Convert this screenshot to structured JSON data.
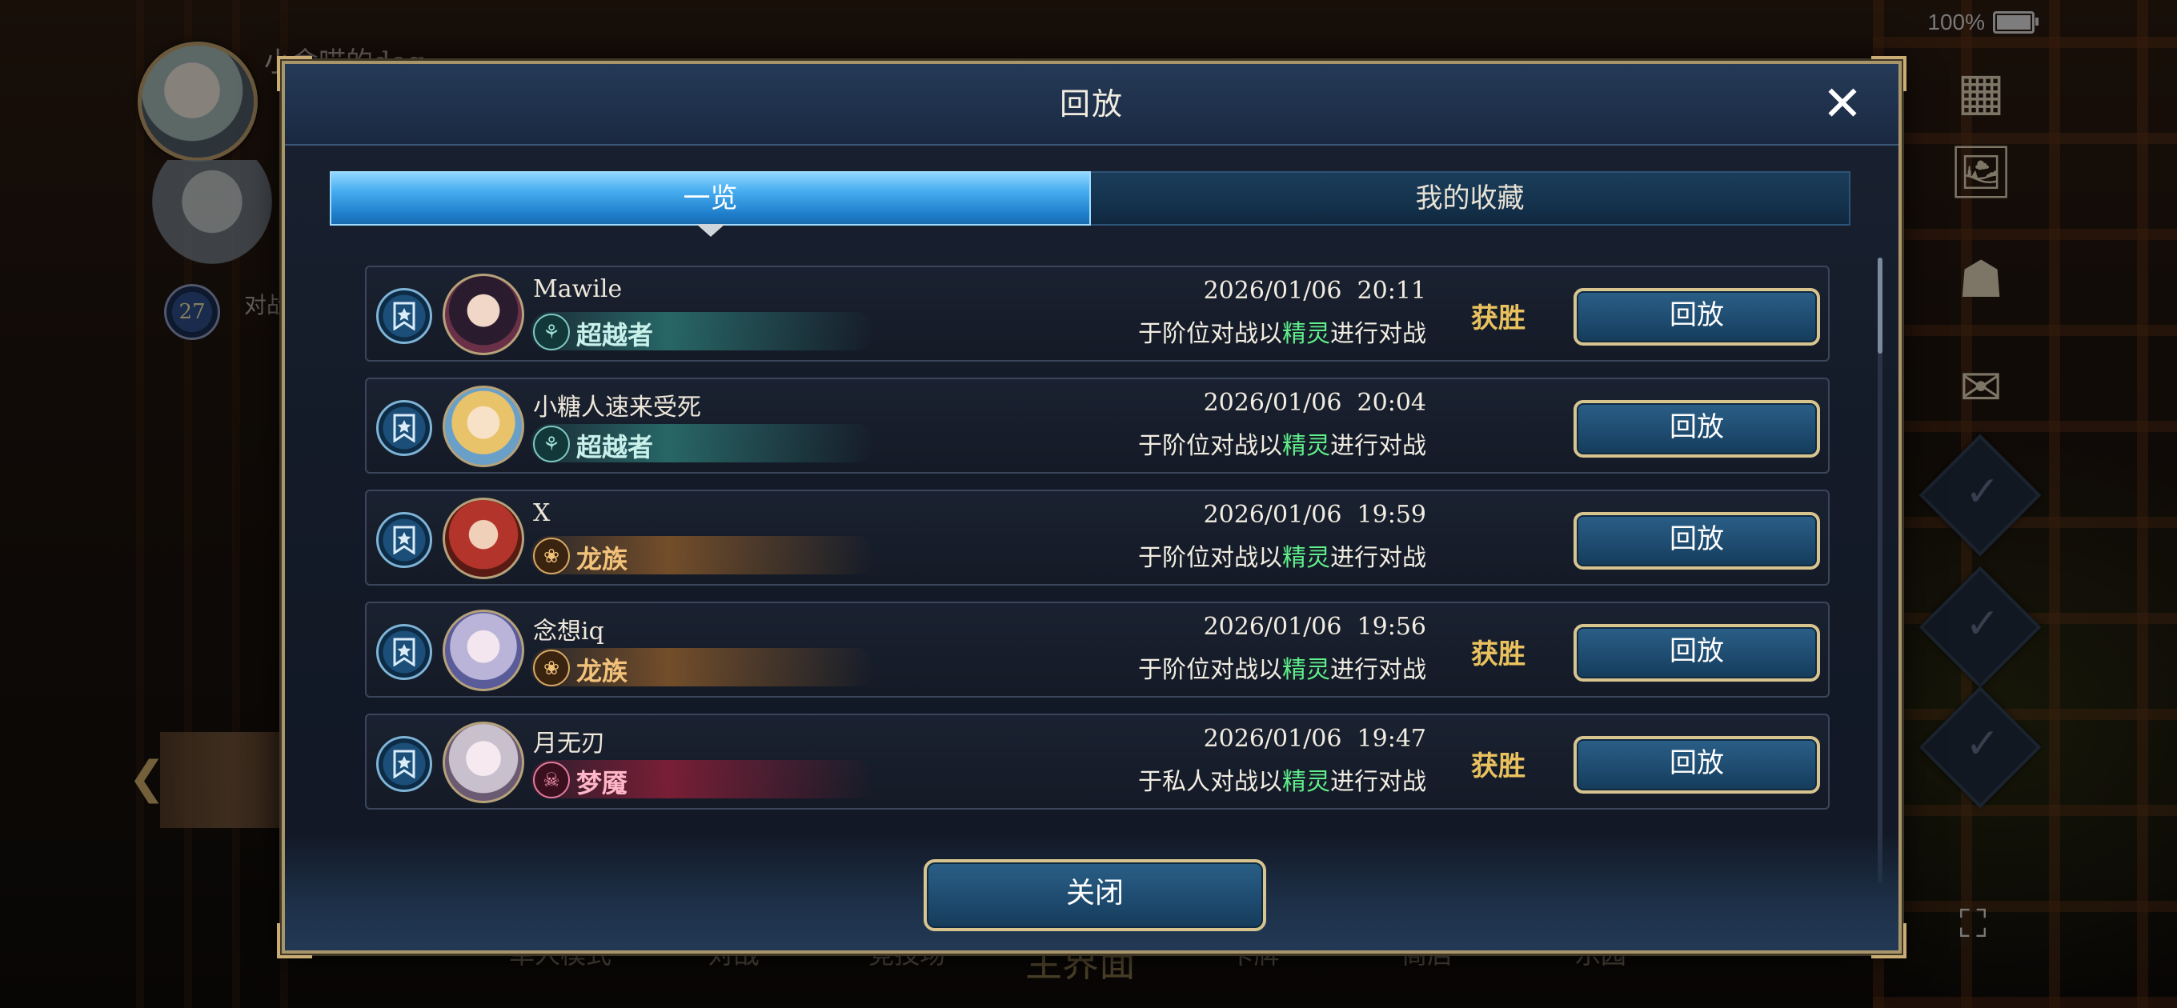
{
  "status": {
    "battery": "100%"
  },
  "background": {
    "player_name": "小舍喵的dog",
    "level": "27",
    "level_label": "对战进行中",
    "nav": [
      "单人模式",
      "对战",
      "竞技场",
      "主界面",
      "卡牌",
      "商店",
      "乐园"
    ]
  },
  "modal": {
    "title": "回放",
    "tabs": [
      {
        "label": "一览",
        "active": true
      },
      {
        "label": "我的收藏",
        "active": false
      }
    ],
    "rows": [
      {
        "player": "Mawile",
        "class": "超越者",
        "class_theme": "teal",
        "datetime": "2026/01/06  20:11",
        "desc_prefix": "于阶位对战以",
        "desc_highlight": "精灵",
        "desc_suffix": "进行对战",
        "result": "获胜",
        "button": "回放"
      },
      {
        "player": "小糖人速来受死",
        "class": "超越者",
        "class_theme": "teal",
        "datetime": "2026/01/06  20:04",
        "desc_prefix": "于阶位对战以",
        "desc_highlight": "精灵",
        "desc_suffix": "进行对战",
        "result": "",
        "button": "回放"
      },
      {
        "player": "X",
        "class": "龙族",
        "class_theme": "orange",
        "datetime": "2026/01/06  19:59",
        "desc_prefix": "于阶位对战以",
        "desc_highlight": "精灵",
        "desc_suffix": "进行对战",
        "result": "",
        "button": "回放"
      },
      {
        "player": "念想iq",
        "class": "龙族",
        "class_theme": "orange",
        "datetime": "2026/01/06  19:56",
        "desc_prefix": "于阶位对战以",
        "desc_highlight": "精灵",
        "desc_suffix": "进行对战",
        "result": "获胜",
        "button": "回放"
      },
      {
        "player": "月无刃",
        "class": "梦魇",
        "class_theme": "crimson",
        "datetime": "2026/01/06  19:47",
        "desc_prefix": "于私人对战以",
        "desc_highlight": "精灵",
        "desc_suffix": "进行对战",
        "result": "获胜",
        "button": "回放"
      }
    ],
    "close_button": "关闭"
  },
  "colors": {
    "accent_blue": "#48aef0",
    "gold_border": "#d8c48f",
    "win_gold": "#e9c25e",
    "highlight_green": "#5ff08a",
    "class_teal": "#2e7f7a",
    "class_orange": "#8a5a2a",
    "class_crimson": "#8a1f38"
  },
  "icons": {
    "close": "close-icon",
    "bookmark": "bookmark-star-icon",
    "side": [
      "grid-icon",
      "image-edit-icon",
      "gift-icon",
      "scroll-icon",
      "fullscreen-icon"
    ]
  }
}
